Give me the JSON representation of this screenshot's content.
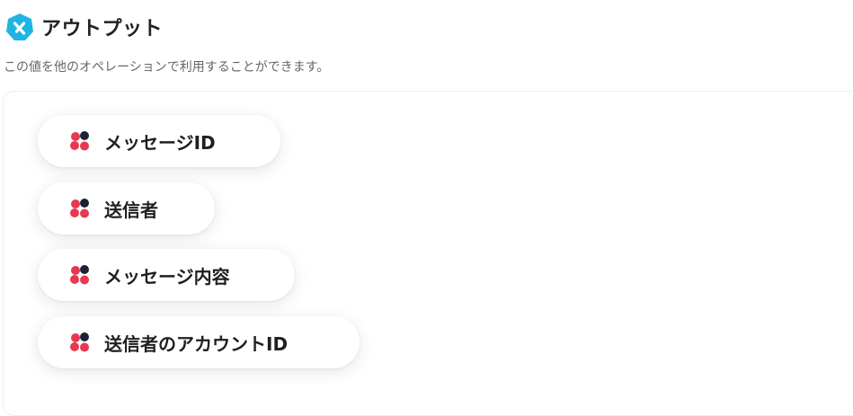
{
  "section": {
    "title": "アウトプット",
    "description": "この値を他のオペレーションで利用することができます。",
    "title_icon": "yoom-logo-icon",
    "accent_color": "#1fb5e3"
  },
  "outputs": [
    {
      "label": "メッセージID",
      "icon": "chatwork-icon"
    },
    {
      "label": "送信者",
      "icon": "chatwork-icon"
    },
    {
      "label": "メッセージ内容",
      "icon": "chatwork-icon"
    },
    {
      "label": "送信者のアカウントID",
      "icon": "chatwork-icon"
    }
  ],
  "chip_icon_colors": {
    "red": "#e8384f",
    "dark": "#1c2233"
  }
}
